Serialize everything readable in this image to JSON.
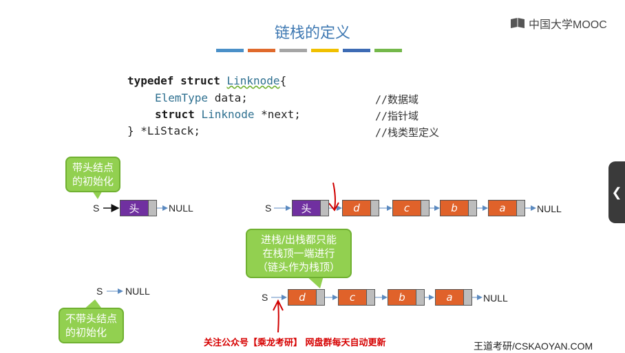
{
  "slide": {
    "title": "链栈的定义",
    "logo_text": "中国大学MOOC",
    "color_bars": [
      "#4a90c8",
      "#e06a2c",
      "#a5a5a5",
      "#f0c000",
      "#3d6bb4",
      "#74b84a"
    ]
  },
  "code": {
    "line1_kw": "typedef struct ",
    "line1_name": "Linknode",
    "line1_end": "{",
    "line2_type": "ElemType",
    "line2_rest": " data;",
    "line3_kw": "struct ",
    "line3_type": "Linknode",
    "line3_rest": " *next;",
    "line4": "} *LiStack;",
    "comment1": "//数据域",
    "comment2": "//指针域",
    "comment3": "//栈类型定义"
  },
  "callouts": {
    "with_head": "带头结点\n的初始化",
    "push_pop_line1_a": "进栈/出栈",
    "push_pop_line1_b": "都只能",
    "push_pop_line2": "在栈顶一端进行",
    "push_pop_line3": "（链头作为栈顶）",
    "without_head": "不带头结点\n的初始化"
  },
  "diagram": {
    "s_label": "S",
    "null_label": "NULL",
    "head_label": "头",
    "elements": [
      "d",
      "c",
      "b",
      "a"
    ]
  },
  "footer": {
    "notice": "关注公众号【乘龙考研】 网盘群每天自动更新",
    "site": "王道考研/CSKAOYAN.COM"
  },
  "side_tab_icon": "chevron-left-icon",
  "colors": {
    "head_node": "#7030a0",
    "element_node": "#e0622a",
    "callout": "#92d050",
    "annotation_red": "#d00000"
  }
}
